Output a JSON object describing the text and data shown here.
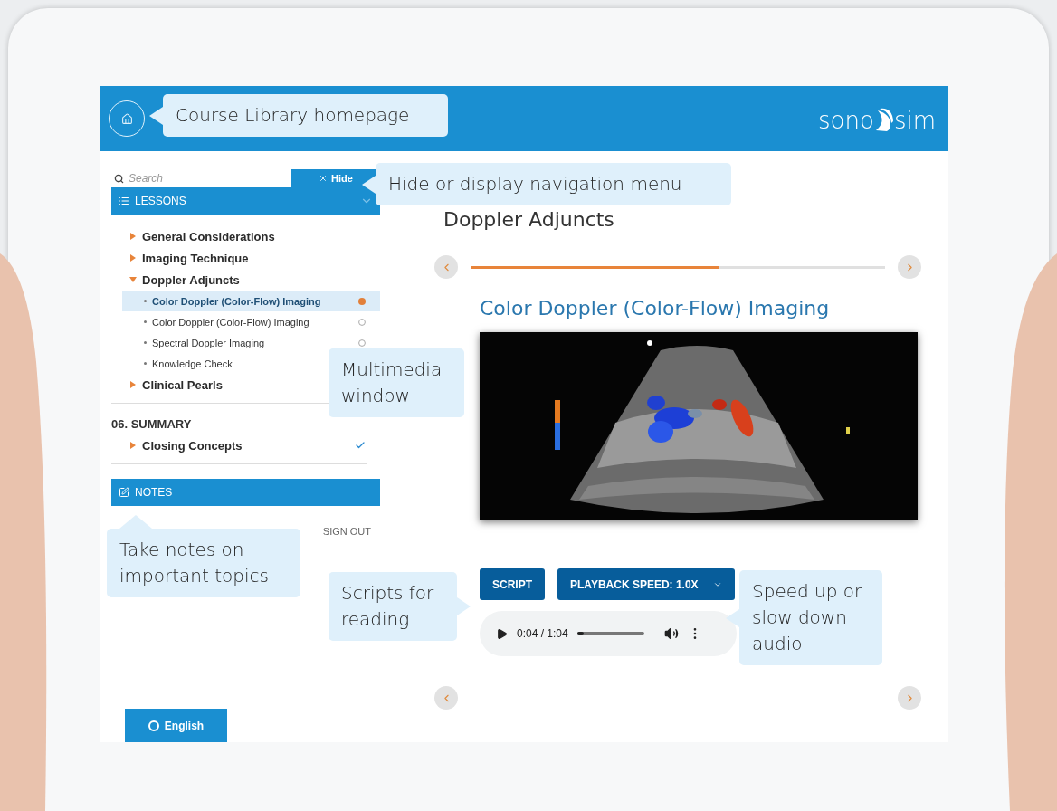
{
  "header": {
    "logo": [
      "sono",
      "sim"
    ]
  },
  "sidebar": {
    "search": {
      "placeholder": "Search"
    },
    "hide_button": {
      "label": "Hide"
    },
    "lessons_label": "LESSONS",
    "groups": [
      {
        "items": [
          {
            "label": "General Considerations",
            "expanded": false
          },
          {
            "label": "Imaging Technique",
            "expanded": false
          },
          {
            "label": "Doppler Adjuncts",
            "expanded": true,
            "children": [
              {
                "label": "Color Doppler (Color-Flow) Imaging",
                "selected": true,
                "current": true
              },
              {
                "label": "Color Doppler (Color-Flow) Imaging",
                "selected": false,
                "current": false
              },
              {
                "label": "Spectral Doppler Imaging",
                "selected": false,
                "current": false
              },
              {
                "label": "Knowledge Check",
                "selected": false
              }
            ]
          },
          {
            "label": "Clinical Pearls",
            "expanded": false
          }
        ]
      },
      {
        "heading": "06. SUMMARY",
        "items": [
          {
            "label": "Closing Concepts",
            "expanded": false,
            "completed": true
          }
        ]
      }
    ],
    "notes_label": "NOTES",
    "sign_out": "SIGN OUT",
    "language_button": "English"
  },
  "main": {
    "title": "Doppler Adjuncts",
    "progress": {
      "level": 0.6
    },
    "section_title": "Color Doppler (Color-Flow) Imaging",
    "script_button": "SCRIPT",
    "speed_button": "PLAYBACK SPEED: 1.0X",
    "audio": {
      "time": "0:04 / 1:04",
      "level": 0.1
    }
  },
  "callouts": [
    {
      "text": "Course Library homepage",
      "kind": "left"
    },
    {
      "text": "Hide or display navigation menu",
      "kind": "left"
    },
    {
      "text": "Multimedia window",
      "kind": "plain"
    },
    {
      "text": "Take notes on important topics",
      "kind": "up"
    },
    {
      "text": "Scripts for reading",
      "kind": "right"
    },
    {
      "text": "Speed up or slow down audio",
      "kind": "left"
    }
  ]
}
